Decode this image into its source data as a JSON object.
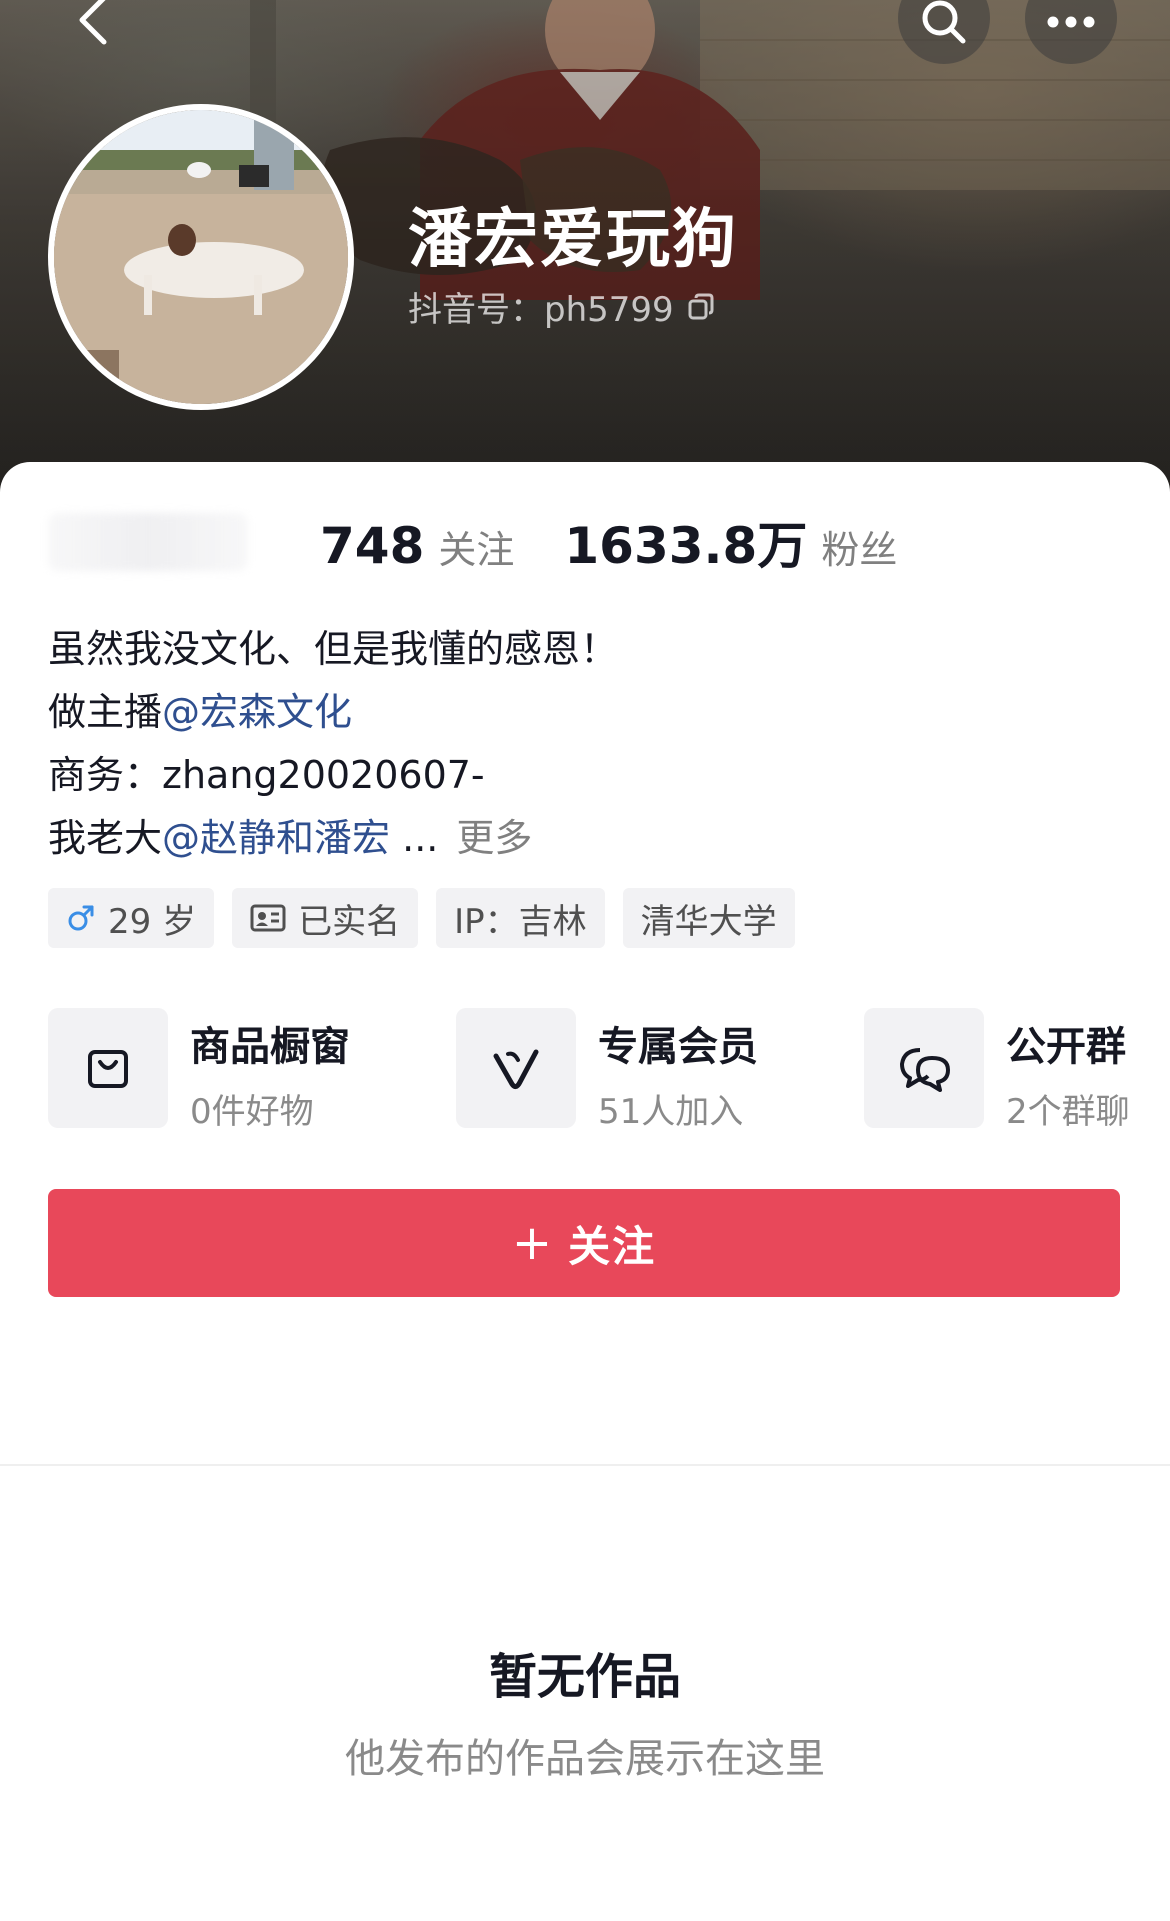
{
  "profile": {
    "name": "潘宏爱玩狗",
    "douyin_id": "抖音号：ph5799"
  },
  "stats": {
    "following_count": "748",
    "following_label": "关注",
    "followers_count": "1633.8万",
    "followers_label": "粉丝"
  },
  "bio": {
    "line1": "虽然我没文化、但是我懂的感恩！",
    "line2_prefix": "做主播",
    "line2_mention": "@宏森文化",
    "line3": "商务：zhang20020607-",
    "line4_prefix": "我老大",
    "line4_mention": "@赵静和潘宏",
    "ellipsis": "...",
    "more": "更多"
  },
  "tags": {
    "age": "29 岁",
    "verified": "已实名",
    "ip": "IP：吉林",
    "school": "清华大学"
  },
  "features": [
    {
      "title": "商品橱窗",
      "subtitle": "0件好物",
      "icon": "shopping-bag-icon"
    },
    {
      "title": "专属会员",
      "subtitle": "51人加入",
      "icon": "member-v-icon"
    },
    {
      "title": "公开群",
      "subtitle": "2个群聊",
      "icon": "chat-bubbles-icon"
    }
  ],
  "follow_button": {
    "plus": "+",
    "label": "关注"
  },
  "empty_state": {
    "title": "暂无作品",
    "subtitle": "他发布的作品会展示在这里"
  },
  "colors": {
    "accent": "#e8485a",
    "mention": "#2f4f8f",
    "male_icon": "#3a8ee6"
  }
}
